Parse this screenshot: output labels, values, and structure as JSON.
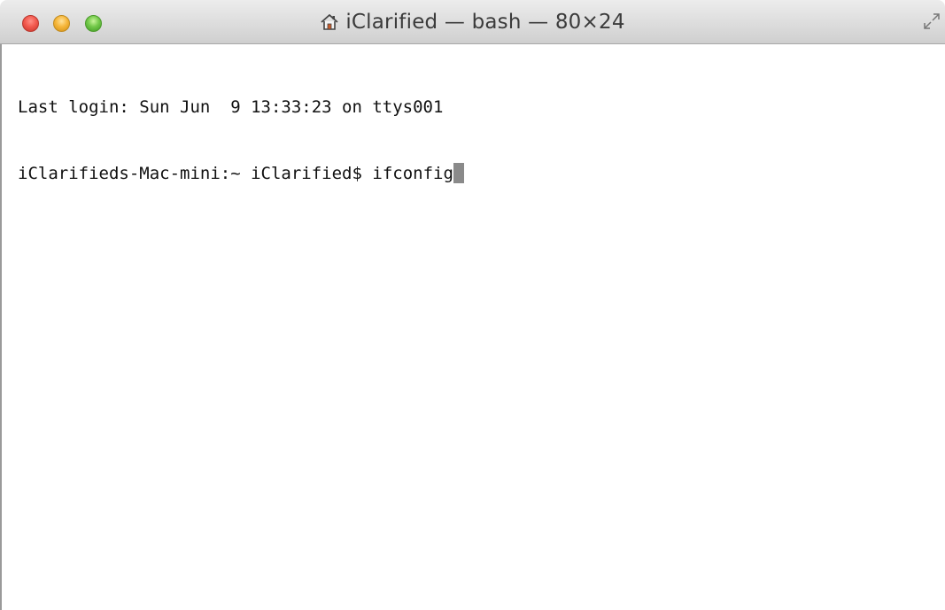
{
  "window": {
    "title": "iClarified — bash — 80×24",
    "title_icon": "home-icon",
    "buttons": {
      "close_color": "#f25a4f",
      "minimize_color": "#f6b73c",
      "zoom_color": "#73c94a"
    }
  },
  "terminal": {
    "lines": [
      "Last login: Sun Jun  9 13:33:23 on ttys001"
    ],
    "prompt": "iClarifieds-Mac-mini:~ iClarified$ ",
    "command": "ifconfig",
    "cursor_color": "#8a8a8a"
  }
}
